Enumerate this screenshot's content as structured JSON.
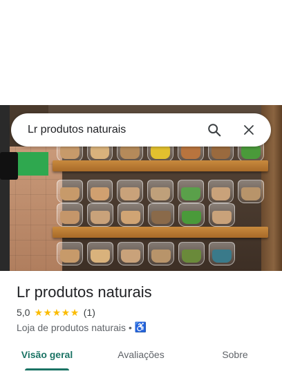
{
  "search": {
    "query": "Lr produtos naturais"
  },
  "icons": {
    "search": "search-icon",
    "close": "close-icon",
    "star": "star-icon",
    "accessibility": "wheelchair-icon"
  },
  "place": {
    "name": "Lr produtos naturais",
    "rating": "5,0",
    "stars": 5,
    "review_count": "(1)",
    "category": "Loja de produtos naturais",
    "separator": "•",
    "accessibility_symbol": "♿"
  },
  "tabs": [
    {
      "label": "Visão geral",
      "active": true
    },
    {
      "label": "Avaliações",
      "active": false
    },
    {
      "label": "Sobre",
      "active": false
    }
  ],
  "colors": {
    "accent": "#1a7364",
    "star": "#fbbc04",
    "link": "#1a73e8"
  }
}
